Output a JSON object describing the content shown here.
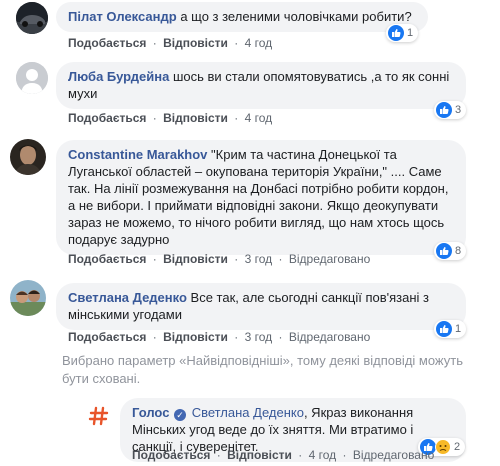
{
  "comments": [
    {
      "author": "Пілат Олександр",
      "text": "а що з зеленими чоловічками робити?",
      "like_label": "Подобається",
      "reply_label": "Відповісти",
      "time": "4 год",
      "reactions": "1"
    },
    {
      "author": "Люба Бурдейна",
      "text": "шось ви стали опомятовуватись ,а то як сонні мухи",
      "like_label": "Подобається",
      "reply_label": "Відповісти",
      "time": "4 год",
      "reactions": "3"
    },
    {
      "author": "Constantine Marakhov",
      "text": "\"Крим та частина Донецької та Луганської областей – окупована територія України,\" .... Саме так. На лінії розмежування на Донбасі потрібно робити кордон, а не вибори. І приймати відповідні закони. Якщо деокупувати зараз не можемо, то нічого робити вигляд, що нам хтось щось подарує задурно",
      "like_label": "Подобається",
      "reply_label": "Відповісти",
      "time": "3 год",
      "edited": "Відредаговано",
      "reactions": "8"
    },
    {
      "author": "Светлана Деденко",
      "text": "Все так, але сьогодні санкції пов'язані з мінськими угодами",
      "like_label": "Подобається",
      "reply_label": "Відповісти",
      "time": "3 год",
      "edited": "Відредаговано",
      "reactions": "1"
    }
  ],
  "notice": "Вибрано параметр «Найвідповідніші», тому деякі відповіді можуть бути сховані.",
  "reply": {
    "author": "Голос",
    "tagged": "Светлана Деденко",
    "text": ", Якраз виконання Мінських угод веде до їх зняття. Ми втратимо і санкції, і суверенітет.",
    "like_label": "Подобається",
    "reply_label": "Відповісти",
    "time": "4 год",
    "edited": "Відредаговано",
    "reactions": "2"
  },
  "separator": "·",
  "colors": {
    "link": "#385898",
    "like": "#1877f2",
    "bubble": "#f2f3f5",
    "meta": "#606770"
  }
}
